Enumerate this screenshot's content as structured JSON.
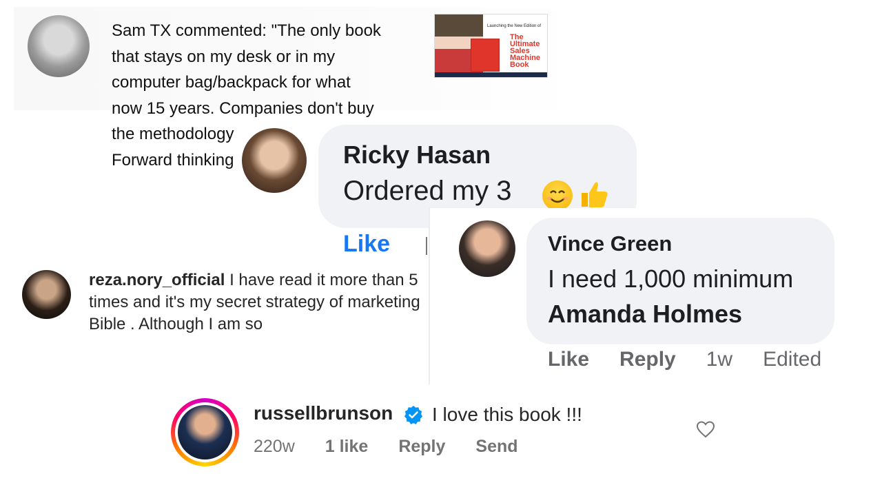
{
  "sam": {
    "comment": "Sam TX commented: \"The only book\nthat stays on my desk or in my\ncomputer bag/backpack for what\nnow 15 years. Companies don't buy\nthe methodology\nForward thinking"
  },
  "book_thumbnail": {
    "small_text": "Launching the New Edition of",
    "title": "The\nUltimate\nSales\nMachine\nBook"
  },
  "ricky": {
    "name": "Ricky Hasan",
    "text": "Ordered my 3",
    "like": "Like"
  },
  "vince": {
    "name": "Vince Green",
    "text": "I need 1,000 minimum",
    "mention": "Amanda Holmes",
    "actions": {
      "like": "Like",
      "reply": "Reply",
      "time": "1w",
      "edited": "Edited"
    }
  },
  "reza": {
    "username": "reza.nory_official",
    "text": " I have read it more than 5 times and it's my secret strategy of marketing Bible . Although I am so"
  },
  "russell": {
    "username": "russellbrunson",
    "text": "I love this book !!!",
    "meta": {
      "time": "220w",
      "likes": "1 like",
      "reply": "Reply",
      "send": "Send"
    }
  },
  "colors": {
    "facebook_blue": "#1877f2",
    "verified_blue": "#0095f6",
    "bubble_gray": "#f0f2f5"
  }
}
